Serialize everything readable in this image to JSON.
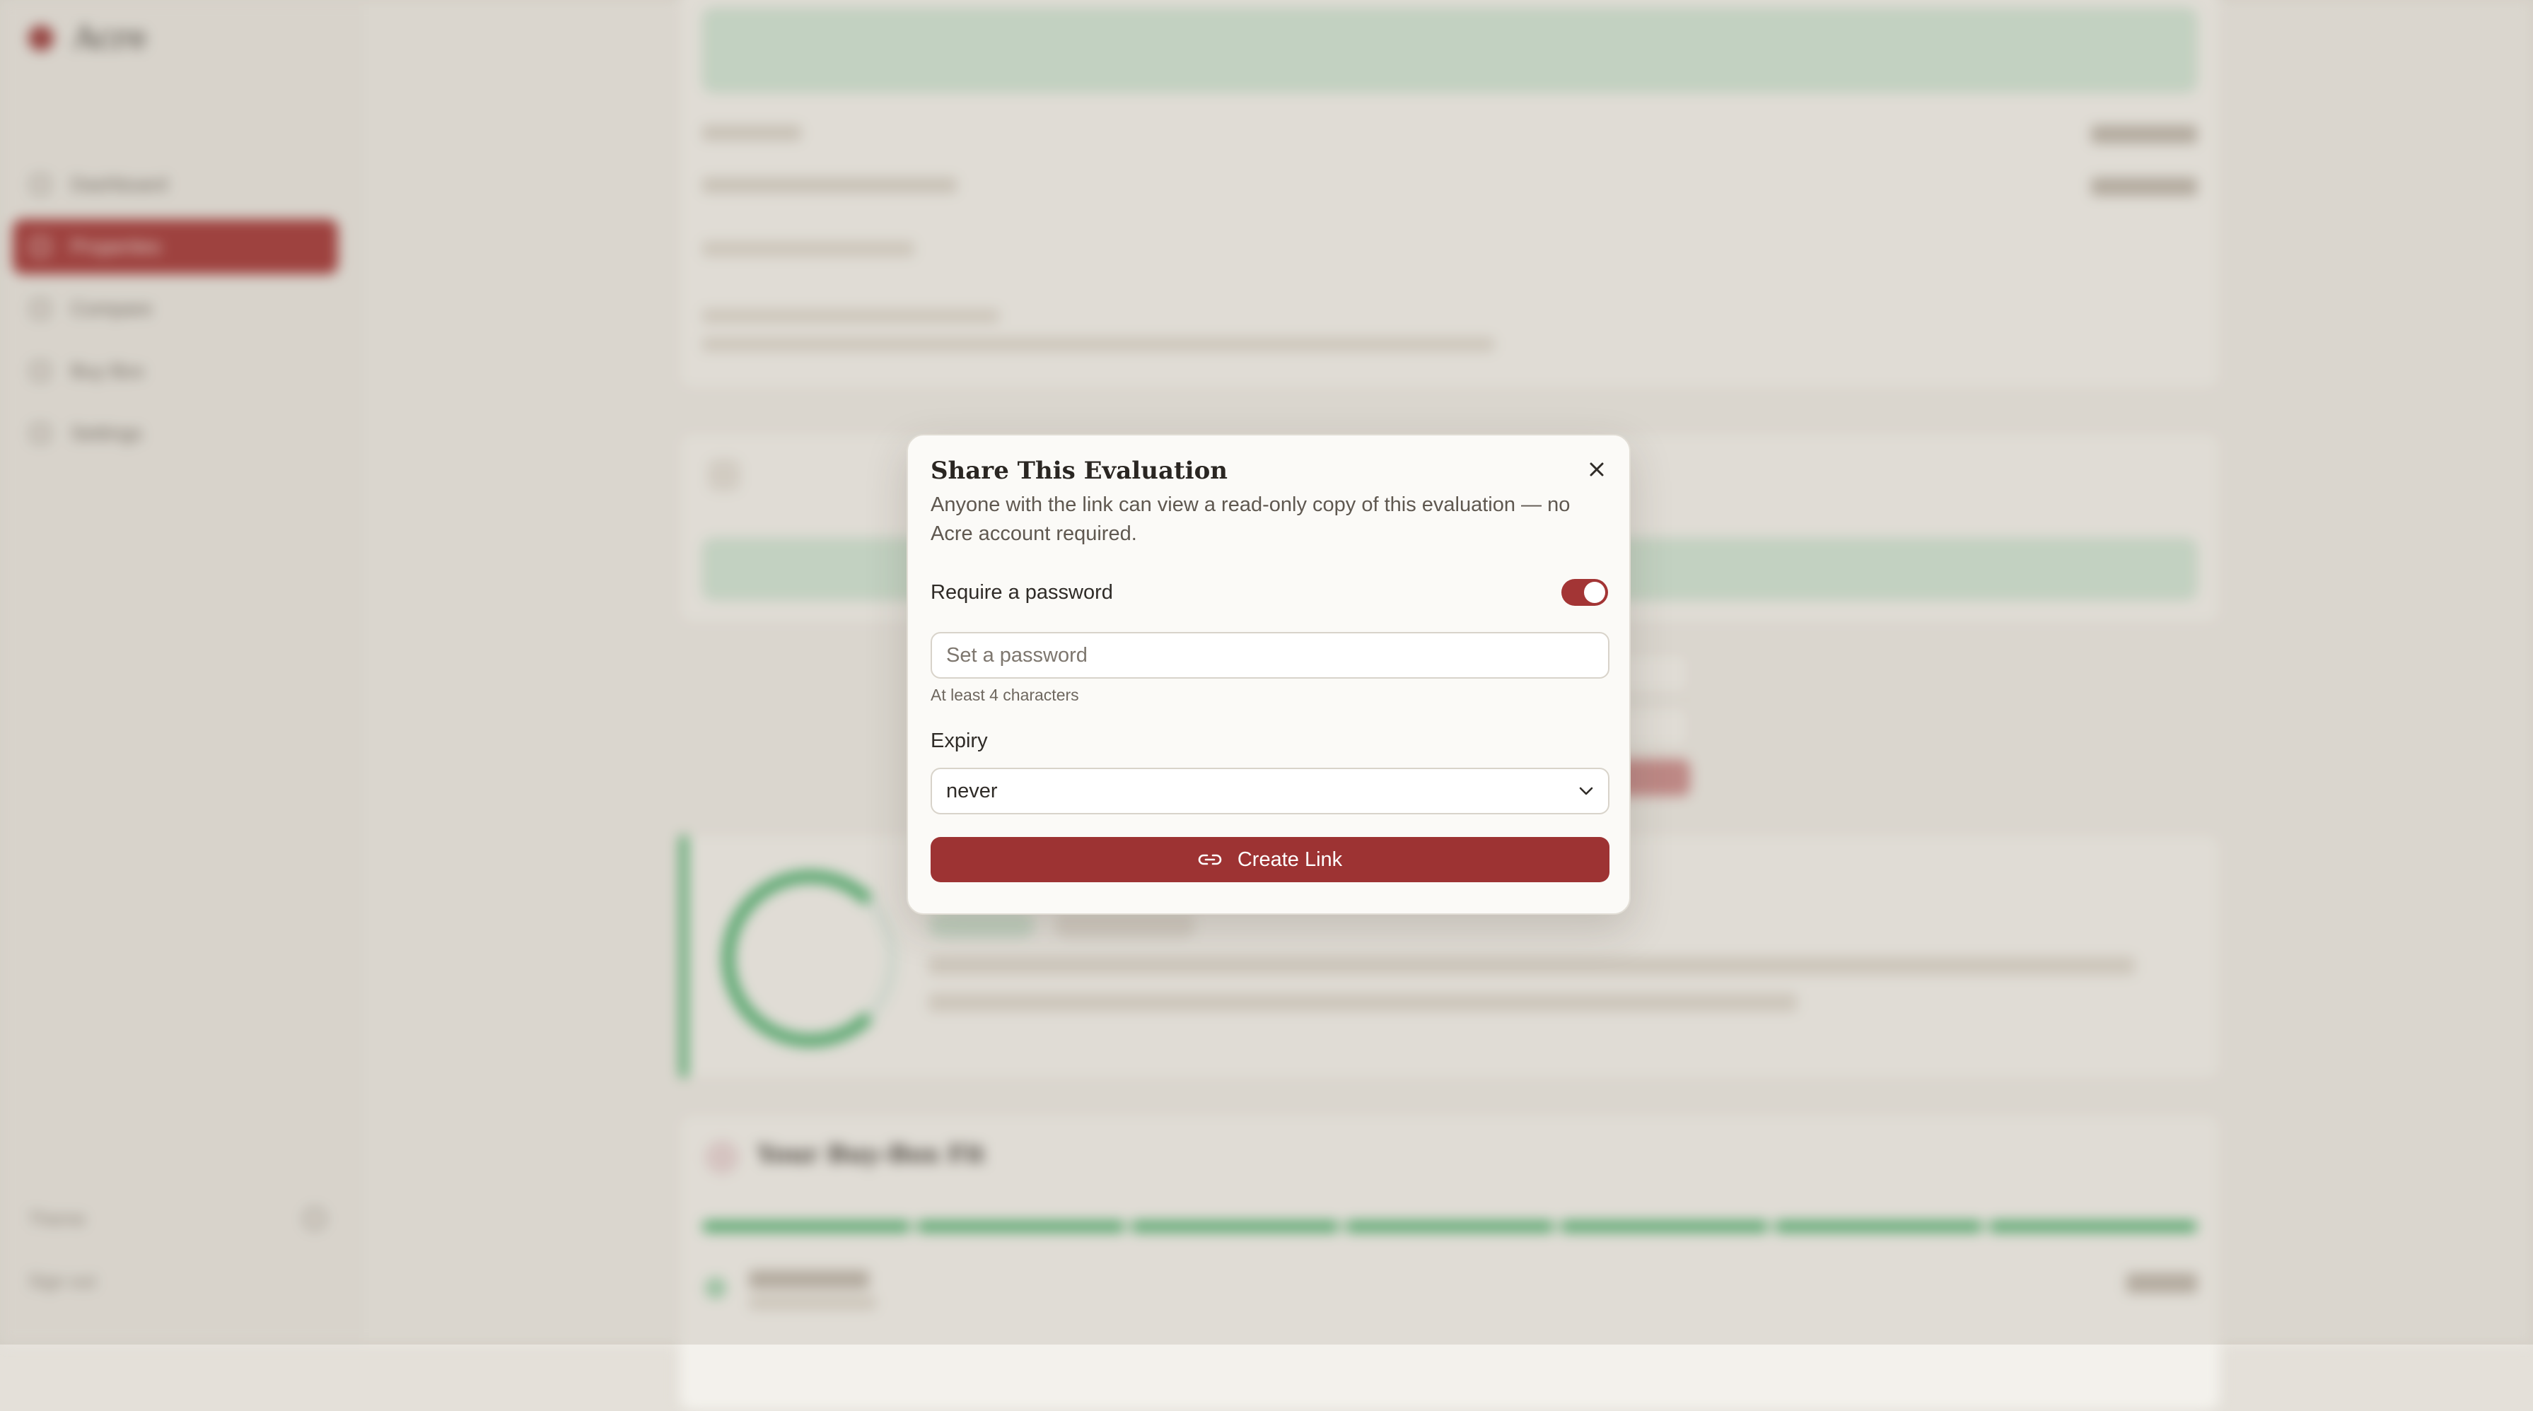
{
  "app": {
    "brand": "Acre",
    "nav": [
      {
        "label": "Dashboard",
        "icon": "dashboard-icon"
      },
      {
        "label": "Properties",
        "icon": "properties-icon",
        "active": true
      },
      {
        "label": "Compare",
        "icon": "compare-icon"
      },
      {
        "label": "Buy Box",
        "icon": "buy-box-icon"
      },
      {
        "label": "Settings",
        "icon": "settings-icon"
      }
    ],
    "footer": {
      "theme_label": "Theme",
      "sign_out_label": "Sign out"
    },
    "main": {
      "fit_card_title": "Your Buy-Box Fit"
    }
  },
  "modal": {
    "title": "Share This Evaluation",
    "description": "Anyone with the link can view a read-only copy of this evaluation — no Acre account required.",
    "password_toggle_label": "Require a password",
    "password_required": true,
    "password_placeholder": "Set a password",
    "password_value": "",
    "password_hint": "At least 4 characters",
    "expiry_label": "Expiry",
    "expiry_value": "never",
    "create_button_label": "Create Link"
  },
  "colors": {
    "accent": "#9d3333",
    "success": "#4db06e",
    "background": "#e4e0d9"
  }
}
